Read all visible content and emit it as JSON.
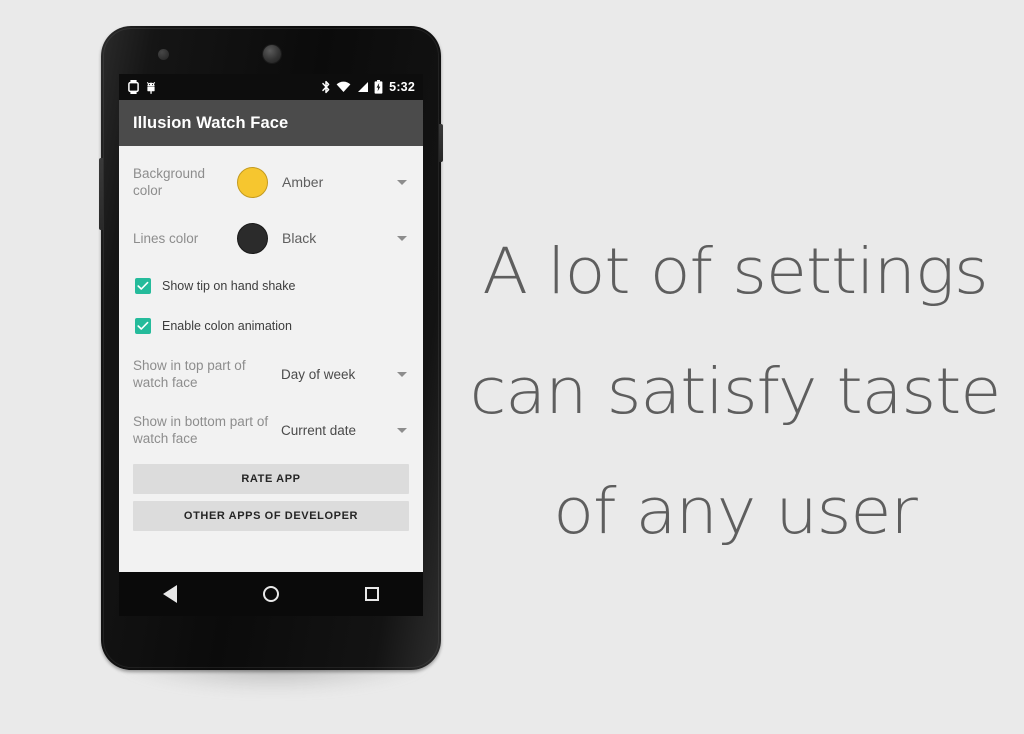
{
  "page": {
    "background_color": "#eaeaea"
  },
  "device": {
    "name": "android-phone-mockup",
    "body_color": "#0b0b0b",
    "status_bar": {
      "background_color": "#0d0d0d",
      "left_icons": [
        "watch-icon",
        "android-debug-icon"
      ],
      "right_icons": [
        "bluetooth-icon",
        "wifi-icon",
        "cell-signal-icon",
        "battery-charging-icon"
      ],
      "clock": "5:32"
    },
    "nav_bar": {
      "background_color": "#0a0a0a",
      "keys": [
        "back-key",
        "home-key",
        "recents-key"
      ]
    }
  },
  "app": {
    "toolbar": {
      "title": "Illusion Watch Face",
      "background_color": "#4b4b4b",
      "title_color": "#ffffff"
    },
    "content_background": "#f2f2f2",
    "color_rows": [
      {
        "label": "Background color",
        "value": "Amber",
        "swatch_color": "#f6c62f",
        "caret": "chevron-down-icon"
      },
      {
        "label": "Lines color",
        "value": "Black",
        "swatch_color": "#2b2b2b",
        "caret": "chevron-down-icon"
      }
    ],
    "checkboxes": [
      {
        "label": "Show tip on hand shake",
        "checked": true,
        "accent_color": "#25bb9b"
      },
      {
        "label": "Enable colon animation",
        "checked": true,
        "accent_color": "#25bb9b"
      }
    ],
    "spinner_rows": [
      {
        "label": "Show in top part of watch face",
        "value": "Day of week",
        "caret": "chevron-down-icon"
      },
      {
        "label": "Show in bottom part of watch face",
        "value": "Current date",
        "caret": "chevron-down-icon"
      }
    ],
    "buttons": [
      {
        "label": "RATE APP",
        "background_color": "#dcdcdc"
      },
      {
        "label": "OTHER APPS OF DEVELOPER",
        "background_color": "#dcdcdc"
      }
    ]
  },
  "marketing": {
    "text_color": "#5e5e5e",
    "lines": [
      "A lot of settings",
      "can satisfy taste",
      "of any user"
    ]
  }
}
